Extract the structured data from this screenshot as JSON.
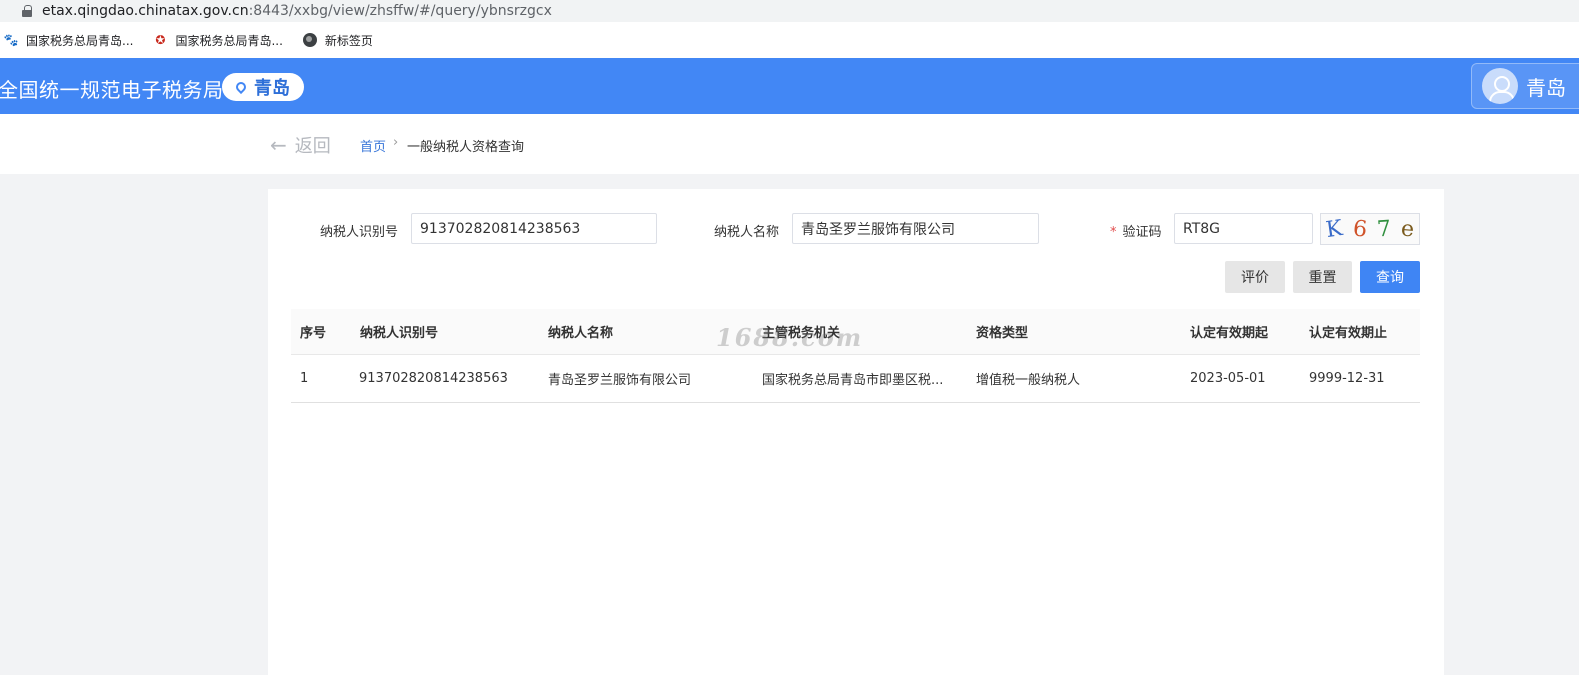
{
  "browser": {
    "url_host": "etax.qingdao.chinatax.gov.cn",
    "url_path": ":8443/xxbg/view/zhsffw/#/query/ybnsrzgcx",
    "bookmarks": [
      {
        "label": "国家税务总局青岛...",
        "icon": "paw-icon"
      },
      {
        "label": "国家税务总局青岛...",
        "icon": "emblem-icon"
      },
      {
        "label": "新标签页",
        "icon": "globe-icon"
      }
    ]
  },
  "header": {
    "title": "全国统一规范电子税务局",
    "city": "青岛",
    "user_name": "青岛"
  },
  "breadcrumb": {
    "back_label": "返回",
    "home": "首页",
    "separator": "›",
    "current": "一般纳税人资格查询"
  },
  "form": {
    "taxpayer_id_label": "纳税人识别号",
    "taxpayer_id_value": "913702820814238563",
    "taxpayer_name_label": "纳税人名称",
    "taxpayer_name_value": "青岛圣罗兰服饰有限公司",
    "captcha_required_mark": "*",
    "captcha_label": "验证码",
    "captcha_value": "RT8G",
    "captcha_chars": [
      "K",
      "6",
      "7",
      "e"
    ]
  },
  "buttons": {
    "evaluate": "评价",
    "reset": "重置",
    "query": "查询"
  },
  "table": {
    "headers": [
      "序号",
      "纳税人识别号",
      "纳税人名称",
      "主管税务机关",
      "资格类型",
      "认定有效期起",
      "认定有效期止"
    ],
    "rows": [
      [
        "1",
        "913702820814238563",
        "青岛圣罗兰服饰有限公司",
        "国家税务总局青岛市即墨区税...",
        "增值税一般纳税人",
        "2023-05-01",
        "9999-12-31"
      ]
    ]
  },
  "watermark": "1688.com",
  "colors": {
    "header_bg": "#4287f5",
    "primary_button": "#3f85f4",
    "link": "#3a77d9",
    "required": "#e14c4c"
  }
}
